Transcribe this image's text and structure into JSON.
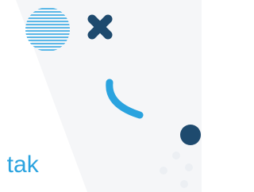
{
  "theme": {
    "background": "#ffffff",
    "panel_color": "#f5f6f8",
    "stripe_color": "#5bb8e8",
    "accent_dark": "#1e4a6e",
    "accent_blue": "#2aa3df",
    "dot_light": "#eceff3"
  },
  "decorations": {
    "striped_circle_icon": "striped-circle",
    "cross_icon": "rounded-x",
    "arc_icon": "arc",
    "dot_icon": "filled-circle",
    "faint_dots_icon": "dots"
  },
  "content": {
    "partial_text": "ı tak"
  }
}
